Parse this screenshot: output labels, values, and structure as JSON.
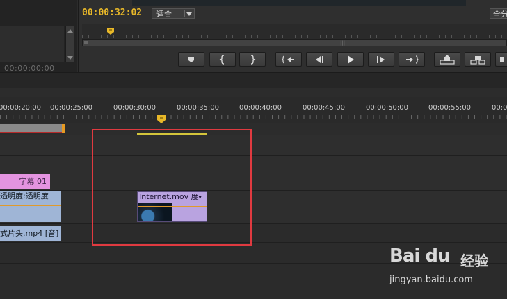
{
  "source_panel": {
    "timecode": "00:00:00:00"
  },
  "program_monitor": {
    "timecode": "00:00:32:02",
    "zoom_value": "适合",
    "full_value": "全分",
    "transport_buttons": [
      {
        "name": "add-marker-button",
        "icon": "marker-icon"
      },
      {
        "name": "mark-in-button",
        "icon": "mark-in-icon"
      },
      {
        "name": "mark-out-button",
        "icon": "mark-out-icon"
      },
      {
        "name": "go-to-in-button",
        "icon": "go-to-in-icon"
      },
      {
        "name": "step-back-button",
        "icon": "step-back-icon"
      },
      {
        "name": "play-button",
        "icon": "play-icon"
      },
      {
        "name": "step-forward-button",
        "icon": "step-forward-icon"
      },
      {
        "name": "go-to-out-button",
        "icon": "go-to-out-icon"
      },
      {
        "name": "lift-button",
        "icon": "lift-icon"
      },
      {
        "name": "extract-button",
        "icon": "extract-icon"
      }
    ]
  },
  "timeline": {
    "ruler_labels": [
      "00:00:20:00",
      "00:00:25:00",
      "00:00:30:00",
      "00:00:35:00",
      "00:00:40:00",
      "00:00:45:00",
      "00:00:50:00",
      "00:00:55:00",
      "00:00:0"
    ],
    "clips": {
      "title_clip": "字幕 01",
      "overlay_clip_header": "透明度:透明度",
      "internet_clip_header": "Internet.mov",
      "internet_clip_suffix": "度",
      "audio_clip": "式片头.mp4 [音]"
    }
  },
  "watermark": {
    "brand": "Bai du",
    "cn": "经验",
    "url": "jingyan.baidu.com"
  },
  "colors": {
    "timecode": "#e8b829",
    "playhead": "#e0383a",
    "highlight": "#e03a40",
    "title_clip": "#e494e0",
    "video_clip": "#9fb5d6",
    "internet_clip": "#b9a3e0"
  }
}
